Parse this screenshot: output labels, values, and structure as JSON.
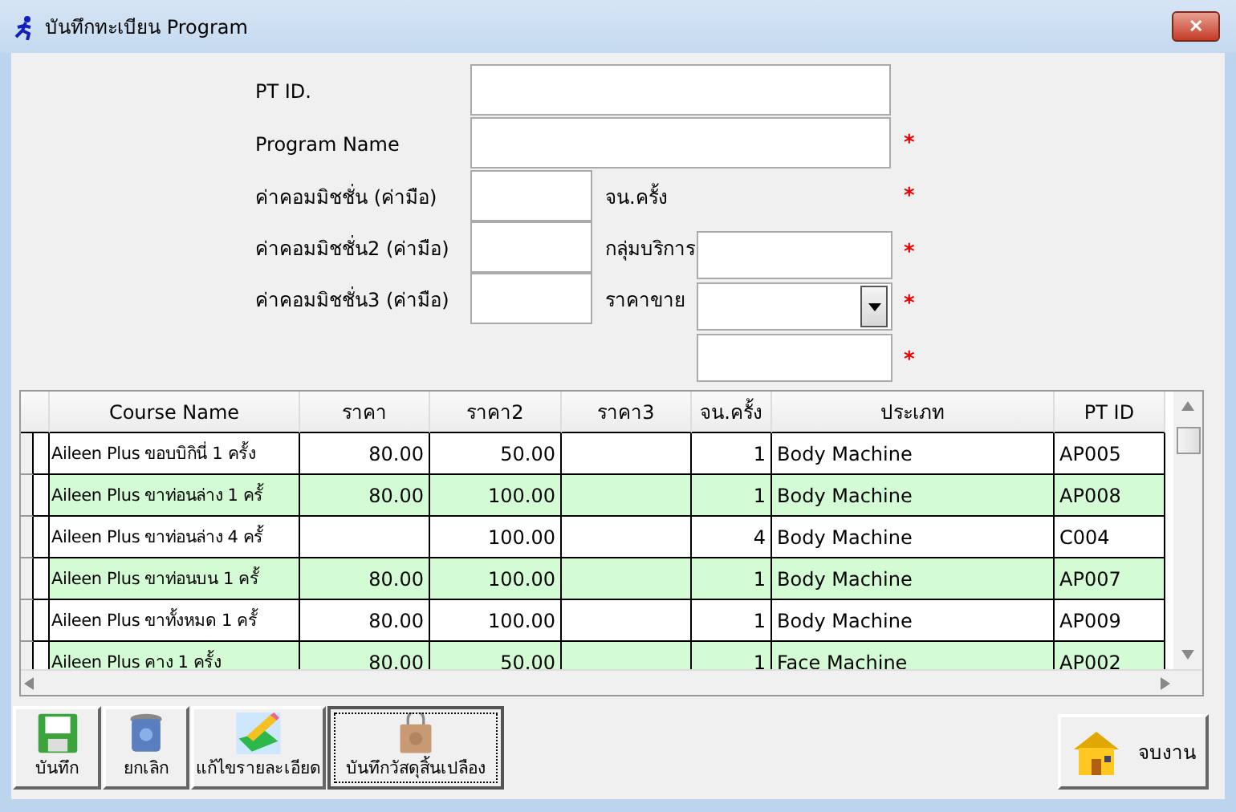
{
  "window": {
    "title": "บันทึกทะเบียน Program",
    "close": "✕"
  },
  "form": {
    "pt_id": {
      "label": "PT ID."
    },
    "program_name": {
      "label": "Program Name",
      "marker": "*"
    },
    "commissions": [
      {
        "label": "ค่าคอมมิชชั่น (ค่ามือ)"
      },
      {
        "label": "ค่าคอมมิชชั่น2 (ค่ามือ)"
      },
      {
        "label": "ค่าคอมมิชชั่น3 (ค่ามือ)"
      }
    ],
    "right": [
      {
        "label": "จน.ครั้ง",
        "kind": "none",
        "marker": "*"
      },
      {
        "label": "กลุ่มบริการ",
        "kind": "text",
        "marker": "*"
      },
      {
        "label": "ราคาขาย",
        "kind": "combo",
        "marker": "*"
      },
      {
        "kind": "text",
        "marker": "*"
      }
    ]
  },
  "table": {
    "columns": [
      "Course Name",
      "ราคา",
      "ราคา2",
      "ราคา3",
      "จน.ครั้ง",
      "ประเภท",
      "PT ID"
    ],
    "rows": [
      [
        "Aileen Plus ขอบบิกินี่ 1 ครั้ง",
        "80.00",
        "50.00",
        "",
        "1",
        "Body Machine",
        "AP005"
      ],
      [
        "Aileen Plus ขาท่อนล่าง 1 ครั้",
        "80.00",
        "100.00",
        "",
        "1",
        "Body Machine",
        "AP008"
      ],
      [
        "Aileen Plus ขาท่อนล่าง 4 ครั้",
        "",
        "100.00",
        "",
        "4",
        "Body Machine",
        "C004"
      ],
      [
        "Aileen Plus ขาท่อนบน 1 ครั้",
        "80.00",
        "100.00",
        "",
        "1",
        "Body Machine",
        "AP007"
      ],
      [
        "Aileen Plus ขาทั้งหมด 1 ครั้",
        "80.00",
        "100.00",
        "",
        "1",
        "Body Machine",
        "AP009"
      ],
      [
        "Aileen Plus คาง 1 ครั้ง",
        "80.00",
        "50.00",
        "",
        "1",
        "Face Machine",
        "AP002"
      ]
    ]
  },
  "buttons": [
    {
      "label": "บันทึก",
      "kind": "save",
      "focused": false
    },
    {
      "label": "ยกเลิก",
      "kind": "cancel",
      "focused": false
    },
    {
      "label": "แก้ไขรายละเอียด",
      "kind": "edit",
      "focused": false
    },
    {
      "label": "บันทึกวัสดุสิ้นเปลือง",
      "kind": "bag",
      "focused": true
    }
  ],
  "exit_button": {
    "label": "จบงาน"
  }
}
